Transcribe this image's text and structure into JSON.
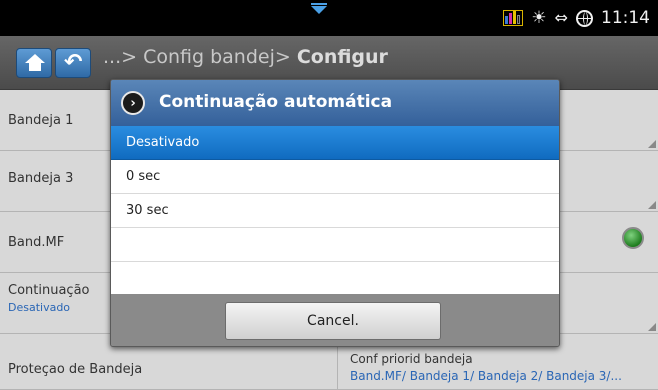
{
  "status": {
    "time": "11:14",
    "icons": [
      "down-arrow-icon",
      "toner-level-icon",
      "sun-icon",
      "network-arrows-icon",
      "globe-icon"
    ],
    "toner_colors": [
      "#3a7bd5",
      "#d52fa8",
      "#e6c300",
      "#1a1a1a"
    ],
    "accent": "#4aa0e6"
  },
  "header": {
    "breadcrumb_prefix": "...> Config bandej> ",
    "breadcrumb_current": "Configur"
  },
  "list": {
    "rows": [
      {
        "label": "Bandeja 1"
      },
      {
        "label": "Bandeja 3"
      },
      {
        "label": "Band.MF"
      },
      {
        "label": "Continuação",
        "sub": "Desativado"
      },
      {
        "label": "Proteçao de Bandeja",
        "right_label": "Conf priorid bandeja",
        "right_sub": "Band.MF/ Bandeja 1/ Bandeja 2/ Bandeja 3/..."
      }
    ]
  },
  "dialog": {
    "title": "Continuação automática",
    "options": [
      "Desativado",
      "0 sec",
      "30 sec",
      "",
      ""
    ],
    "selected_index": 0,
    "cancel_label": "Cancel."
  },
  "colors": {
    "selected": "#1478cc",
    "title_bar": "#4673a9",
    "link": "#2a66b5"
  }
}
